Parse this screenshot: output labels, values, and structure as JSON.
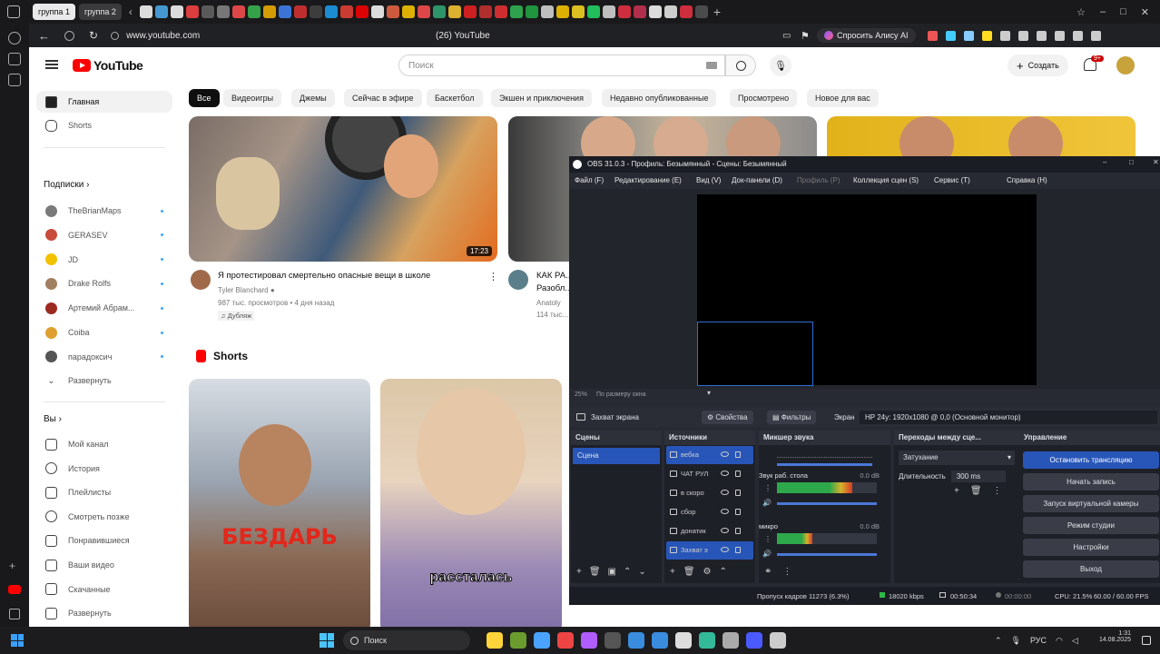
{
  "browser": {
    "tabs": [
      "группа 1",
      "группа 2"
    ],
    "url": "www.youtube.com",
    "page_title": "(26) YouTube",
    "alice_label": "Спросить Алису AI"
  },
  "youtube": {
    "logo": "YouTube",
    "search_placeholder": "Поиск",
    "create_label": "Создать",
    "notif_count": "9+",
    "sidebar": {
      "home": "Главная",
      "shorts": "Shorts",
      "subscriptions_header": "Подписки",
      "subscriptions": [
        "TheBrianMaps",
        "GERASEV",
        "JD",
        "Drake Rolfs",
        "Артемий Абрам...",
        "Coiba",
        "парадоксич"
      ],
      "expand": "Развернуть",
      "you_header": "Вы",
      "you_items": [
        "Мой канал",
        "История",
        "Плейлисты",
        "Смотреть позже",
        "Понравившиеся",
        "Ваши видео",
        "Скачанные",
        "Развернуть"
      ]
    },
    "chips": [
      "Все",
      "Видеоигры",
      "Джемы",
      "Сейчас в эфире",
      "Баскетбол",
      "Экшен и приключения",
      "Недавно опубликованные",
      "Просмотрено",
      "Новое для вас"
    ],
    "videos": [
      {
        "title": "Я протестировал смертельно опасные вещи в школе",
        "channel": "Tyler Blanchard",
        "meta": "987 тыс. просмотров • 4 дня назад",
        "badge": "Дубляж",
        "duration": "17:23"
      },
      {
        "title": "КАК РА...",
        "line2": "Разобл...",
        "channel": "Anatoly",
        "meta": "114 тыс..."
      }
    ],
    "shorts_header": "Shorts",
    "shorts": [
      {
        "overlay": "БЕЗДАРЬ"
      },
      {
        "overlay": "рассталась"
      }
    ]
  },
  "obs": {
    "title": "OBS 31.0.3 - Профиль: Безымянный - Сцены: Безымянный",
    "menu": [
      "Файл (F)",
      "Редактирование (E)",
      "Вид (V)",
      "Док-панели (D)",
      "Профиль (P)",
      "Коллекция сцен (S)",
      "Сервис (T)",
      "Справка (H)"
    ],
    "zoom_label": "25%",
    "fit_label": "По размеру окна",
    "source_bar": {
      "source_name": "Захват экрана",
      "properties": "Свойства",
      "filters": "Фильтры",
      "screen_label": "Экран",
      "screen_value": "HP 24y: 1920x1080 @ 0,0 (Основной монитор)"
    },
    "scenes": {
      "header": "Сцены",
      "items": [
        "Сцена"
      ]
    },
    "sources": {
      "header": "Источники",
      "items": [
        "вебка",
        "ЧАТ РУЛ",
        "в скоро",
        "сбор",
        "донатик",
        "Захват э"
      ]
    },
    "mixer": {
      "header": "Микшер звука",
      "channels": [
        {
          "name": "Звук раб. стола",
          "db": "0.0 dB",
          "level": 0.75
        },
        {
          "name": "микро",
          "db": "0.0 dB",
          "level": 0.35
        }
      ]
    },
    "transitions": {
      "header": "Переходы между сце...",
      "type": "Затухание",
      "duration_label": "Длительность",
      "duration_value": "300 ms"
    },
    "controls": {
      "header": "Управление",
      "buttons": [
        "Остановить трансляцию",
        "Начать запись",
        "Запуск виртуальной камеры",
        "Режим студии",
        "Настройки",
        "Выход"
      ]
    },
    "status": {
      "dropped": "Пропуск кадров 11273 (6.3%)",
      "bitrate": "18020 kbps",
      "live_time": "00:50:34",
      "rec_time": "00:00:00",
      "cpu": "CPU: 21.5%",
      "fps": "60.00 / 60.00 FPS"
    }
  },
  "taskbar": {
    "search": "Поиск",
    "lang": "РУС",
    "time": "1:31",
    "date": "14.08.2025"
  }
}
